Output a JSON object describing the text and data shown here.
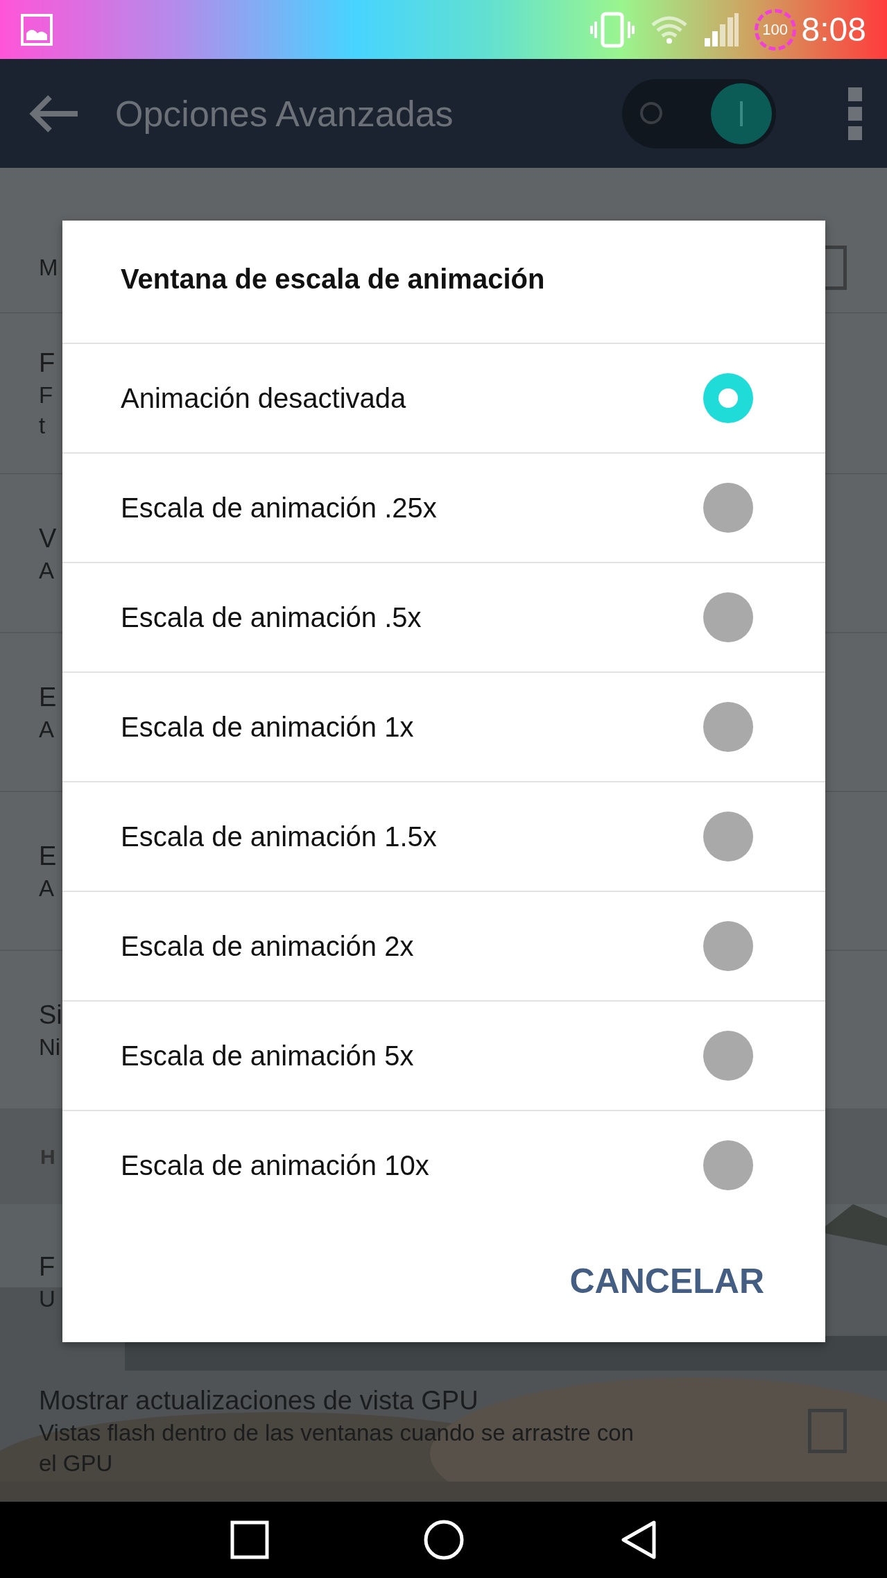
{
  "status_bar": {
    "battery": "100",
    "time": "8:08"
  },
  "app_bar": {
    "title": "Opciones Avanzadas",
    "switch_on": true
  },
  "settings": [
    {
      "kind": "setting",
      "subtitle_lines": [
        "M"
      ],
      "checked": false
    },
    {
      "kind": "setting",
      "title": "F",
      "subtitle_lines": [
        "F",
        "t"
      ]
    },
    {
      "kind": "setting",
      "title": "V",
      "subtitle_lines": [
        "A"
      ]
    },
    {
      "kind": "setting",
      "title": "E",
      "subtitle_lines": [
        "A"
      ]
    },
    {
      "kind": "setting",
      "title": "E",
      "subtitle_lines": [
        "A"
      ]
    },
    {
      "kind": "setting",
      "title": "Si",
      "subtitle_lines": [
        "Ni"
      ]
    },
    {
      "kind": "header",
      "title": "H"
    },
    {
      "kind": "setting",
      "title": "F",
      "subtitle_lines": [
        "U"
      ]
    },
    {
      "kind": "setting",
      "title": "Mostrar actualizaciones de vista GPU",
      "subtitle_lines": [
        "Vistas flash dentro de las ventanas cuando se arrastre con",
        "el GPU"
      ],
      "checked": false
    }
  ],
  "dialog": {
    "title": "Ventana de escala de animación",
    "options": [
      {
        "label": "Animación desactivada",
        "selected": true
      },
      {
        "label": "Escala de animación .25x",
        "selected": false
      },
      {
        "label": "Escala de animación .5x",
        "selected": false
      },
      {
        "label": "Escala de animación 1x",
        "selected": false
      },
      {
        "label": "Escala de animación 1.5x",
        "selected": false
      },
      {
        "label": "Escala de animación 2x",
        "selected": false
      },
      {
        "label": "Escala de animación 5x",
        "selected": false
      },
      {
        "label": "Escala de animación 10x",
        "selected": false
      }
    ],
    "cancel": "CANCELAR"
  }
}
